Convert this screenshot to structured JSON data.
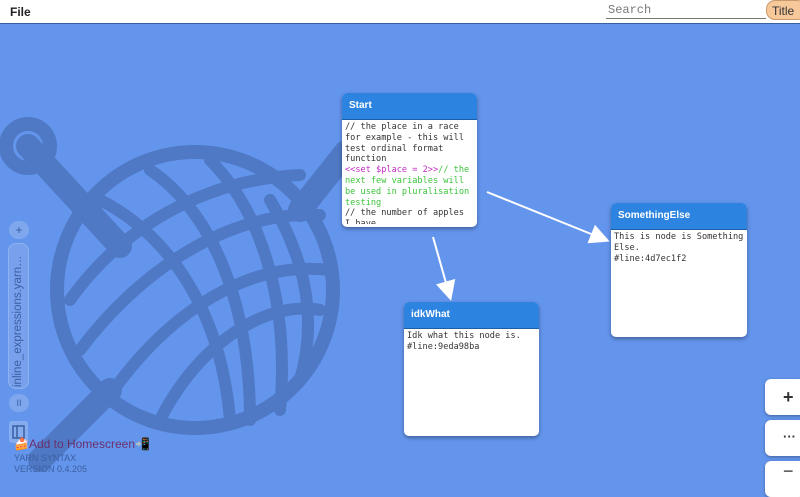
{
  "menu": {
    "file_label": "File"
  },
  "search": {
    "placeholder": "Search",
    "value": ""
  },
  "title_button": {
    "label": "Title"
  },
  "colors": {
    "background": "#6495ed",
    "node_header": "#2d84e0",
    "command": "#c42ec4",
    "comment_green": "#3cc43c",
    "title_button": "#f6c89a"
  },
  "nodes": [
    {
      "title": "Start",
      "body": [
        {
          "text": "// the place in a race for example - this will test ordinal format function",
          "style": "plain"
        },
        {
          "text": "<<set $place = 2>>",
          "style": "command"
        },
        {
          "text": "// the next few variables will be used in pluralisation testing",
          "style": "comment"
        },
        {
          "text": "// the number of apples I have",
          "style": "plain"
        }
      ]
    },
    {
      "title": "SomethingElse",
      "body": [
        {
          "text": "This is node is Something Else.\n#line:4d7ec1f2",
          "style": "plain"
        }
      ]
    },
    {
      "title": "idkWhat",
      "body": [
        {
          "text": "Idk what this node is.\n#line:9eda98ba",
          "style": "plain"
        }
      ]
    }
  ],
  "sidebar": {
    "add_label": "+",
    "file_tab_label": "inline_expressions.yarn…",
    "pause_label": "II",
    "panel_icon": "panel-toggle-icon",
    "add_to_homescreen": "🍰Add to Homescreen📲",
    "syntax_label": "YARN SYNTAX",
    "version_label": "VERSION 0.4.205"
  },
  "right_buttons": {
    "add_label": "+",
    "more_label": "···",
    "minus_label": "−"
  }
}
